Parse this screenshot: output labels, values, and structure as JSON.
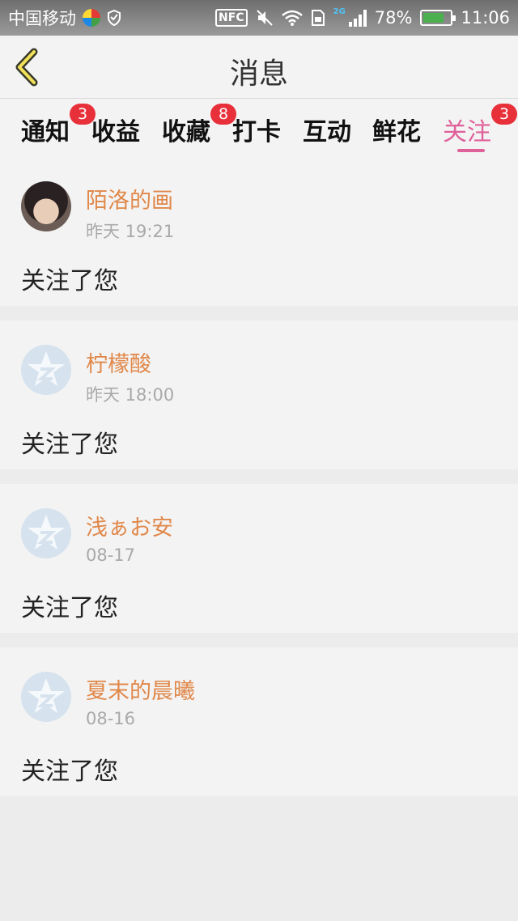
{
  "status_bar": {
    "carrier": "中国移动",
    "nfc": "NFC",
    "network": "2G",
    "battery": "78%",
    "battery_level": 0.78,
    "time": "11:06"
  },
  "header": {
    "title": "消息",
    "back_icon": "chevron-left-icon"
  },
  "tabs": [
    {
      "label": "通知",
      "badge": "3",
      "active": false
    },
    {
      "label": "收益",
      "badge": "",
      "active": false
    },
    {
      "label": "收藏",
      "badge": "8",
      "active": false
    },
    {
      "label": "打卡",
      "badge": "",
      "active": false
    },
    {
      "label": "互动",
      "badge": "",
      "active": false
    },
    {
      "label": "鲜花",
      "badge": "",
      "active": false
    },
    {
      "label": "关注",
      "badge": "3",
      "active": true
    }
  ],
  "items": [
    {
      "name": "陌洛的画",
      "time": "昨天 19:21",
      "message": "关注了您",
      "avatar": "photo"
    },
    {
      "name": "柠檬酸",
      "time": "昨天 18:00",
      "message": "关注了您",
      "avatar": "default-star-avatar-icon"
    },
    {
      "name": "浅ぁお安",
      "time": "08-17",
      "message": "关注了您",
      "avatar": "default-star-avatar-icon"
    },
    {
      "name": "夏末的晨曦",
      "time": "08-16",
      "message": "关注了您",
      "avatar": "default-star-avatar-icon"
    }
  ],
  "colors": {
    "accent": "#e0609a",
    "name": "#e0884a",
    "badge": "#e8303a"
  }
}
